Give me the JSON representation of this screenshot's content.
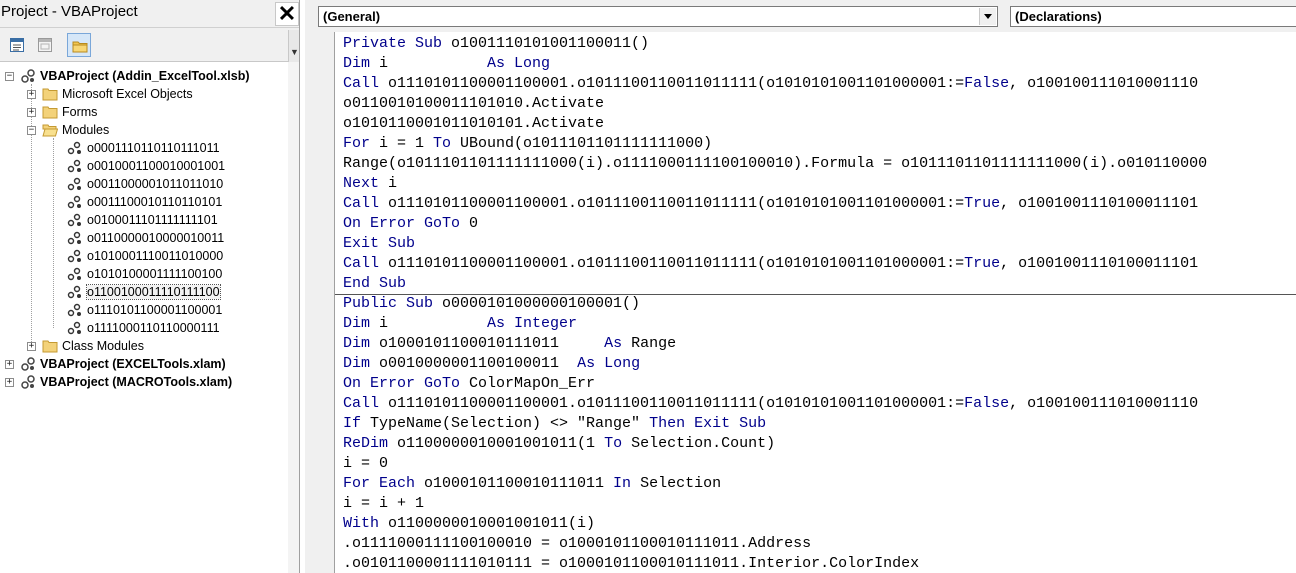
{
  "project_pane": {
    "title": "Project - VBAProject",
    "close_glyph": "✕",
    "toolbar": [
      "view-code-icon",
      "view-object-icon",
      "toggle-folders-icon"
    ],
    "tree": {
      "projects": [
        {
          "label": "VBAProject (Addin_ExcelTool.xlsb)",
          "expanded": true
        },
        {
          "label": "VBAProject (EXCELTools.xlam)",
          "expanded": false
        },
        {
          "label": "VBAProject (MACROTools.xlam)",
          "expanded": false
        }
      ],
      "folders": [
        {
          "label": "Microsoft Excel Objects",
          "expanded": false
        },
        {
          "label": "Forms",
          "expanded": false
        },
        {
          "label": "Modules",
          "expanded": true
        },
        {
          "label": "Class Modules",
          "expanded": false
        }
      ],
      "modules": [
        "o0001110110110111011",
        "o0010001100010001001",
        "o0011000001011011010",
        "o0011100010110110101",
        "o0100011101111111101",
        "o0110000010000010011",
        "o1010001110011010000",
        "o1010100001111100100",
        "o1100100011110111100",
        "o1110101100001100001",
        "o1111000110110000111"
      ],
      "selected_module": "o1100100011110111100"
    }
  },
  "code_pane": {
    "object_combo": "(General)",
    "procedure_combo": "(Declarations)",
    "lines": [
      [
        [
          "kw",
          "Private Sub "
        ],
        [
          "tx",
          "o1001110101001100011()"
        ]
      ],
      [
        [
          "kw",
          "Dim "
        ],
        [
          "tx",
          "i           "
        ],
        [
          "kw",
          "As Long"
        ]
      ],
      [
        [
          "kw",
          "Call "
        ],
        [
          "tx",
          "o1110101100001100001.o1011100110011011111(o1010101001101000001:="
        ],
        [
          "kw",
          "False"
        ],
        [
          "tx",
          ", o100100111010001110"
        ]
      ],
      [
        [
          "tx",
          "o0110010100011101010.Activate"
        ]
      ],
      [
        [
          "tx",
          "o1010110001011010101.Activate"
        ]
      ],
      [
        [
          "kw",
          "For "
        ],
        [
          "tx",
          "i = 1 "
        ],
        [
          "kw",
          "To "
        ],
        [
          "tx",
          "UBound(o1011101101111111000)"
        ]
      ],
      [
        [
          "tx",
          "Range(o1011101101111111000(i).o1111000111100100010).Formula = o1011101101111111000(i).o010110000"
        ]
      ],
      [
        [
          "kw",
          "Next "
        ],
        [
          "tx",
          "i"
        ]
      ],
      [
        [
          "kw",
          "Call "
        ],
        [
          "tx",
          "o1110101100001100001.o1011100110011011111(o1010101001101000001:="
        ],
        [
          "kw",
          "True"
        ],
        [
          "tx",
          ", o1001001110100011101"
        ]
      ],
      [
        [
          "kw",
          "On Error GoTo "
        ],
        [
          "tx",
          "0"
        ]
      ],
      [
        [
          "kw",
          "Exit Sub"
        ]
      ],
      [
        [
          "kw",
          "Call "
        ],
        [
          "tx",
          "o1110101100001100001.o1011100110011011111(o1010101001101000001:="
        ],
        [
          "kw",
          "True"
        ],
        [
          "tx",
          ", o1001001110100011101"
        ]
      ],
      [
        [
          "kw",
          "End Sub"
        ]
      ],
      [
        [
          "kw",
          "Public Sub "
        ],
        [
          "tx",
          "o0000101000000100001()"
        ]
      ],
      [
        [
          "kw",
          "Dim "
        ],
        [
          "tx",
          "i           "
        ],
        [
          "kw",
          "As Integer"
        ]
      ],
      [
        [
          "kw",
          "Dim "
        ],
        [
          "tx",
          "o1000101100010111011     "
        ],
        [
          "kw",
          "As "
        ],
        [
          "tx",
          "Range"
        ]
      ],
      [
        [
          "kw",
          "Dim "
        ],
        [
          "tx",
          "o0010000001100100011  "
        ],
        [
          "kw",
          "As Long"
        ]
      ],
      [
        [
          "kw",
          "On Error GoTo "
        ],
        [
          "tx",
          "ColorMapOn_Err"
        ]
      ],
      [
        [
          "kw",
          "Call "
        ],
        [
          "tx",
          "o1110101100001100001.o1011100110011011111(o1010101001101000001:="
        ],
        [
          "kw",
          "False"
        ],
        [
          "tx",
          ", o100100111010001110"
        ]
      ],
      [
        [
          "kw",
          "If "
        ],
        [
          "tx",
          "TypeName(Selection) <> \"Range\" "
        ],
        [
          "kw",
          "Then Exit Sub"
        ]
      ],
      [
        [
          "kw",
          "ReDim "
        ],
        [
          "tx",
          "o1100000010001001011(1 "
        ],
        [
          "kw",
          "To "
        ],
        [
          "tx",
          "Selection.Count)"
        ]
      ],
      [
        [
          "tx",
          "i = 0"
        ]
      ],
      [
        [
          "kw",
          "For Each "
        ],
        [
          "tx",
          "o1000101100010111011 "
        ],
        [
          "kw",
          "In "
        ],
        [
          "tx",
          "Selection"
        ]
      ],
      [
        [
          "tx",
          "i = i + 1"
        ]
      ],
      [
        [
          "kw",
          "With "
        ],
        [
          "tx",
          "o1100000010001001011(i)"
        ]
      ],
      [
        [
          "tx",
          ".o1111000111100100010 = o1000101100010111011.Address"
        ]
      ],
      [
        [
          "tx",
          ".o0101100001111010111 = o1000101100010111011.Interior.ColorIndex"
        ]
      ]
    ]
  }
}
